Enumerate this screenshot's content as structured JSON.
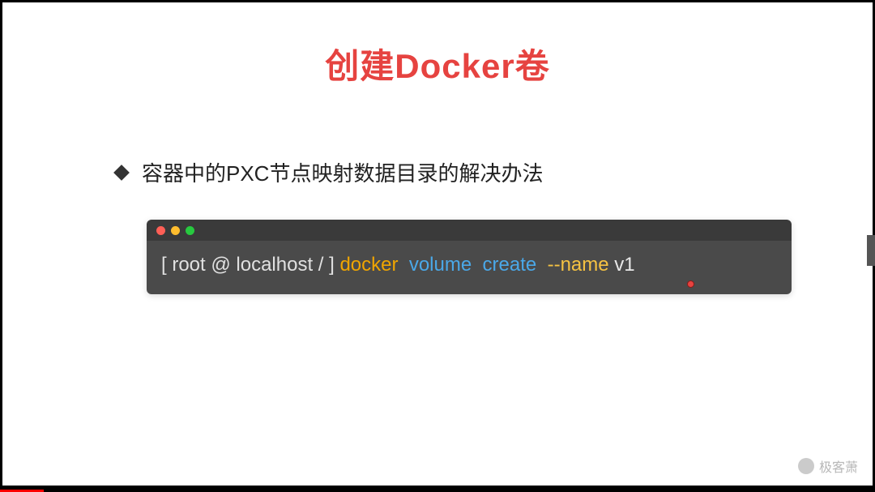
{
  "slide": {
    "title": "创建Docker卷",
    "bullet": "容器中的PXC节点映射数据目录的解决办法"
  },
  "terminal": {
    "prompt": "[ root @ localhost / ] ",
    "docker": "docker  ",
    "volume": "volume  ",
    "create": "create  ",
    "name_flag": "--name ",
    "volume_name": "v1"
  },
  "watermark": {
    "icon": "●",
    "text": "极客萧"
  }
}
